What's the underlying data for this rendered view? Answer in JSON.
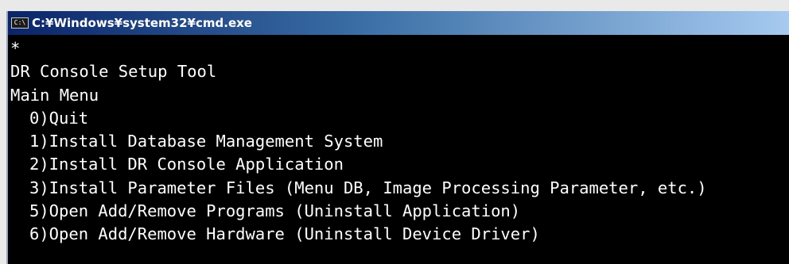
{
  "window": {
    "title": "C:¥Windows¥system32¥cmd.exe",
    "icon": "cmd-icon",
    "icon_glyph": "C:\\"
  },
  "console": {
    "lines": [
      "*",
      "DR Console Setup Tool",
      "Main Menu"
    ],
    "menu_items": [
      "0)Quit",
      "1)Install Database Management System",
      "2)Install DR Console Application",
      "3)Install Parameter Files (Menu DB, Image Processing Parameter, etc.)",
      "5)Open Add/Remove Programs (Uninstall Application)",
      "6)Open Add/Remove Hardware (Uninstall Device Driver)"
    ]
  },
  "colors": {
    "console_bg": "#000000",
    "console_fg": "#ffffff",
    "titlebar_start": "#0a246a",
    "titlebar_end": "#a6caf0"
  }
}
